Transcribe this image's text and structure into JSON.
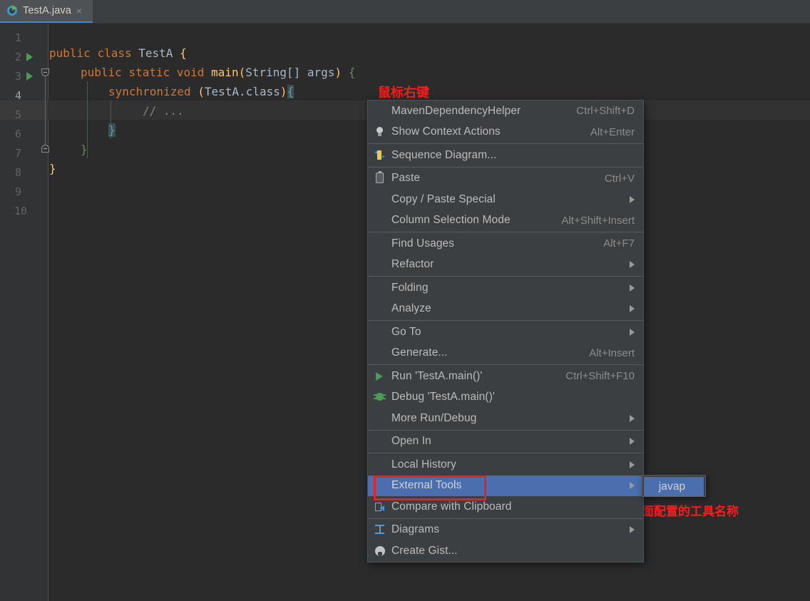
{
  "window": {
    "background": "#2b2b2b",
    "tabbar_background": "#3c3f41"
  },
  "tab": {
    "label": "TestA.java",
    "icon": "java-class-icon",
    "close_label": "×"
  },
  "editor": {
    "gutter_lines": [
      {
        "number": "1",
        "run": false,
        "current": false
      },
      {
        "number": "2",
        "run": true,
        "current": false
      },
      {
        "number": "3",
        "run": true,
        "current": false
      },
      {
        "number": "4",
        "run": false,
        "current": true
      },
      {
        "number": "5",
        "run": false,
        "current": false
      },
      {
        "number": "6",
        "run": false,
        "current": false
      },
      {
        "number": "7",
        "run": false,
        "current": false
      },
      {
        "number": "8",
        "run": false,
        "current": false
      },
      {
        "number": "9",
        "run": false,
        "current": false
      },
      {
        "number": "10",
        "run": false,
        "current": false
      }
    ],
    "code_lines": [
      {
        "line": 2,
        "text": "public class TestA {"
      },
      {
        "line": 3,
        "text": "    public static void main(String[] args) {"
      },
      {
        "line": 4,
        "text": "        synchronized (TestA.class){"
      },
      {
        "line": 5,
        "text": "            // ..."
      },
      {
        "line": 6,
        "text": "        }"
      },
      {
        "line": 7,
        "text": "    }"
      },
      {
        "line": 8,
        "text": "}"
      }
    ],
    "tokens": {
      "l2_public": "public",
      "l2_class": "class",
      "l2_name": "TestA",
      "l2_brace": "{",
      "l3_public": "public",
      "l3_static": "static",
      "l3_void": "void",
      "l3_main": "main",
      "l3_paren_open": "(",
      "l3_string": "String[]",
      "l3_args": " args",
      "l3_paren_close": ")",
      "l3_brace": "{",
      "l4_sync": "synchronized",
      "l4_paren_open": "(",
      "l4_testa": "TestA",
      "l4_dot": ".",
      "l4_class": "class",
      "l4_paren_close": ")",
      "l4_brace": "{",
      "l5_comment": "// ...",
      "l6_brace": "}",
      "l7_brace": "}",
      "l8_brace": "}"
    }
  },
  "annotations": [
    {
      "name": "right-click-note",
      "text": "鼠标右键",
      "color": "#ff1a1a"
    },
    {
      "name": "click-tool-note",
      "text": "点击上面配置的工具名称",
      "color": "#ff1a1a"
    }
  ],
  "context_menu": {
    "items": [
      {
        "id": "maven-dependency-helper",
        "icon": null,
        "label": "MavenDependencyHelper",
        "shortcut": "Ctrl+Shift+D",
        "arrow": false,
        "selected": false
      },
      {
        "id": "show-context-actions",
        "icon": "lightbulb-icon",
        "label": "Show Context Actions",
        "shortcut": "Alt+Enter",
        "arrow": false,
        "selected": false
      },
      {
        "separator": true
      },
      {
        "id": "sequence-diagram",
        "icon": "sequence-diagram-icon",
        "label": "Sequence Diagram...",
        "shortcut": "",
        "arrow": false,
        "selected": false
      },
      {
        "separator": true
      },
      {
        "id": "paste",
        "icon": "clipboard-icon",
        "label": "Paste",
        "shortcut": "Ctrl+V",
        "arrow": false,
        "selected": false,
        "mnemonic": "P"
      },
      {
        "id": "copy-paste-special",
        "icon": null,
        "label": "Copy / Paste Special",
        "shortcut": "",
        "arrow": true,
        "selected": false
      },
      {
        "id": "column-selection-mode",
        "icon": null,
        "label": "Column Selection Mode",
        "shortcut": "Alt+Shift+Insert",
        "arrow": false,
        "selected": false,
        "mnemonic": "M"
      },
      {
        "separator": true
      },
      {
        "id": "find-usages",
        "icon": null,
        "label": "Find Usages",
        "shortcut": "Alt+F7",
        "arrow": false,
        "selected": false,
        "mnemonic": "U"
      },
      {
        "id": "refactor",
        "icon": null,
        "label": "Refactor",
        "shortcut": "",
        "arrow": true,
        "selected": false,
        "mnemonic": "R"
      },
      {
        "separator": true
      },
      {
        "id": "folding",
        "icon": null,
        "label": "Folding",
        "shortcut": "",
        "arrow": true,
        "selected": false
      },
      {
        "id": "analyze",
        "icon": null,
        "label": "Analyze",
        "shortcut": "",
        "arrow": true,
        "selected": false,
        "mnemonic": "z"
      },
      {
        "separator": true
      },
      {
        "id": "go-to",
        "icon": null,
        "label": "Go To",
        "shortcut": "",
        "arrow": true,
        "selected": false
      },
      {
        "id": "generate",
        "icon": null,
        "label": "Generate...",
        "shortcut": "Alt+Insert",
        "arrow": false,
        "selected": false
      },
      {
        "separator": true
      },
      {
        "id": "run-testa-main",
        "icon": "run-play-icon",
        "label": "Run 'TestA.main()'",
        "shortcut": "Ctrl+Shift+F10",
        "arrow": false,
        "selected": false,
        "mnemonic": "u"
      },
      {
        "id": "debug-testa-main",
        "icon": "debug-bug-icon",
        "label": "Debug 'TestA.main()'",
        "shortcut": "",
        "arrow": false,
        "selected": false,
        "mnemonic": "D"
      },
      {
        "id": "more-run-debug",
        "icon": null,
        "label": "More Run/Debug",
        "shortcut": "",
        "arrow": true,
        "selected": false
      },
      {
        "separator": true
      },
      {
        "id": "open-in",
        "icon": null,
        "label": "Open In",
        "shortcut": "",
        "arrow": true,
        "selected": false
      },
      {
        "separator": true
      },
      {
        "id": "local-history",
        "icon": null,
        "label": "Local History",
        "shortcut": "",
        "arrow": true,
        "selected": false,
        "mnemonic": "H"
      },
      {
        "id": "external-tools",
        "icon": null,
        "label": "External Tools",
        "shortcut": "",
        "arrow": true,
        "selected": true
      },
      {
        "id": "compare-with-clipboard",
        "icon": "compare-icon",
        "label": "Compare with Clipboard",
        "shortcut": "",
        "arrow": false,
        "selected": false,
        "mnemonic": "b"
      },
      {
        "separator": true
      },
      {
        "id": "diagrams",
        "icon": "diagrams-icon",
        "label": "Diagrams",
        "shortcut": "",
        "arrow": true,
        "selected": false
      },
      {
        "id": "create-gist",
        "icon": "github-icon",
        "label": "Create Gist...",
        "shortcut": "",
        "arrow": false,
        "selected": false
      }
    ]
  },
  "submenu": {
    "items": [
      {
        "id": "javap",
        "label": "javap",
        "selected": true
      }
    ]
  },
  "colors": {
    "selection": "#4b6eaf",
    "annotation_red": "#ee1c25",
    "keyword": "#cc7832",
    "identifier": "#ffc66d",
    "text": "#a9b7c6",
    "comment": "#808080",
    "run_green": "#499c54"
  }
}
